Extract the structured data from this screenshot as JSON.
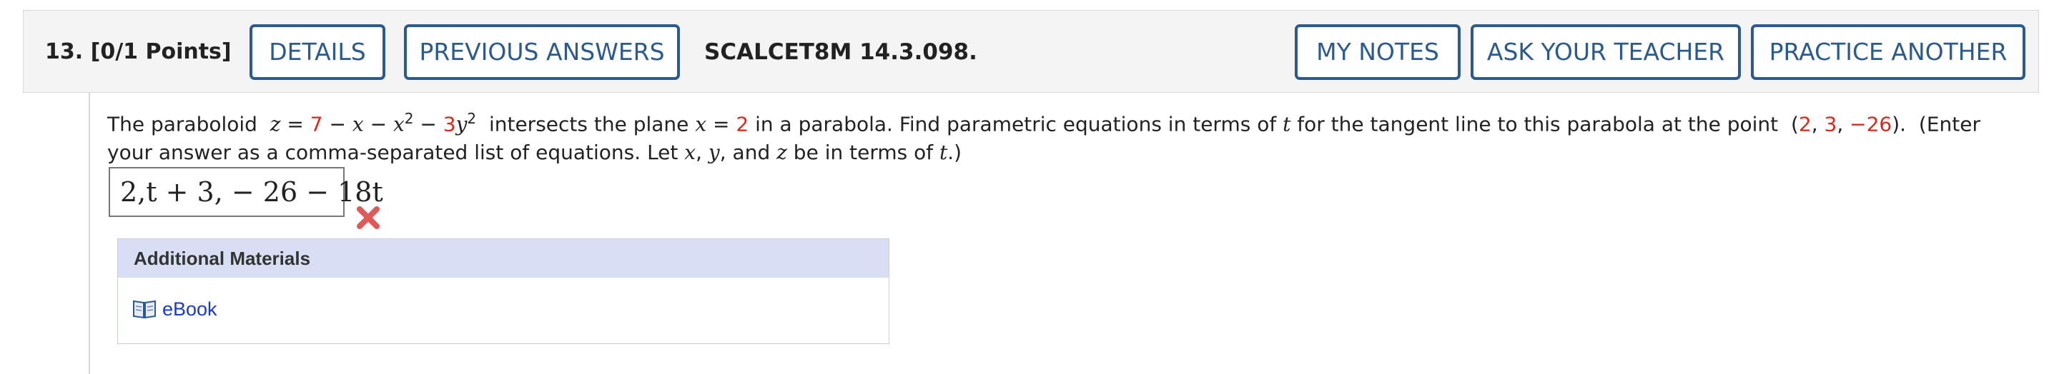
{
  "header": {
    "question_number": "13.",
    "points": "[0/1 Points]",
    "buttons": {
      "details": "DETAILS",
      "previous_answers": "PREVIOUS ANSWERS",
      "my_notes": "MY NOTES",
      "ask_teacher": "ASK YOUR TEACHER",
      "practice_another": "PRACTICE ANOTHER"
    },
    "assignment_id": "SCALCET8M 14.3.098."
  },
  "question": {
    "part1": "The paraboloid",
    "eq_z": "z",
    "eq_equals": " = ",
    "eq_7": "7",
    "eq_rest_a": " − ",
    "eq_x": "x",
    "eq_rest_b": " − ",
    "eq_x2": "x",
    "eq_sup2a": "2",
    "eq_rest_c": " − ",
    "eq_3": "3",
    "eq_y": "y",
    "eq_sup2b": "2",
    "part2": "intersects the plane",
    "plane_x": "x",
    "plane_eq": " = ",
    "plane_val": "2",
    "part3": "in a parabola. Find parametric equations in terms of",
    "t1": "t",
    "part4": "for the tangent line to this parabola at the point",
    "point_open": "(",
    "pt_a": "2",
    "comma1": ", ",
    "pt_b": "3",
    "comma2": ", ",
    "pt_c": "−26",
    "point_close": ").",
    "part5": "(Enter your answer as a comma-separated list of equations. Let",
    "var_x": "x",
    "c_a": ",",
    "var_y": "y",
    "c_b": ", and",
    "var_z": "z",
    "part6": "be in terms of",
    "t2": "t",
    "part7": ".)"
  },
  "answer": {
    "value": "2,t + 3, − 26 − 18t",
    "status": "incorrect"
  },
  "materials": {
    "title": "Additional Materials",
    "ebook_label": "eBook"
  },
  "colors": {
    "accent": "#2a5a8e",
    "red_values": "#d42a20",
    "link": "#1a3ac8",
    "materials_header": "#d8def3",
    "x_mark": "#e05a5a"
  },
  "icons": {
    "incorrect": "x-mark-icon",
    "ebook": "book-icon"
  }
}
